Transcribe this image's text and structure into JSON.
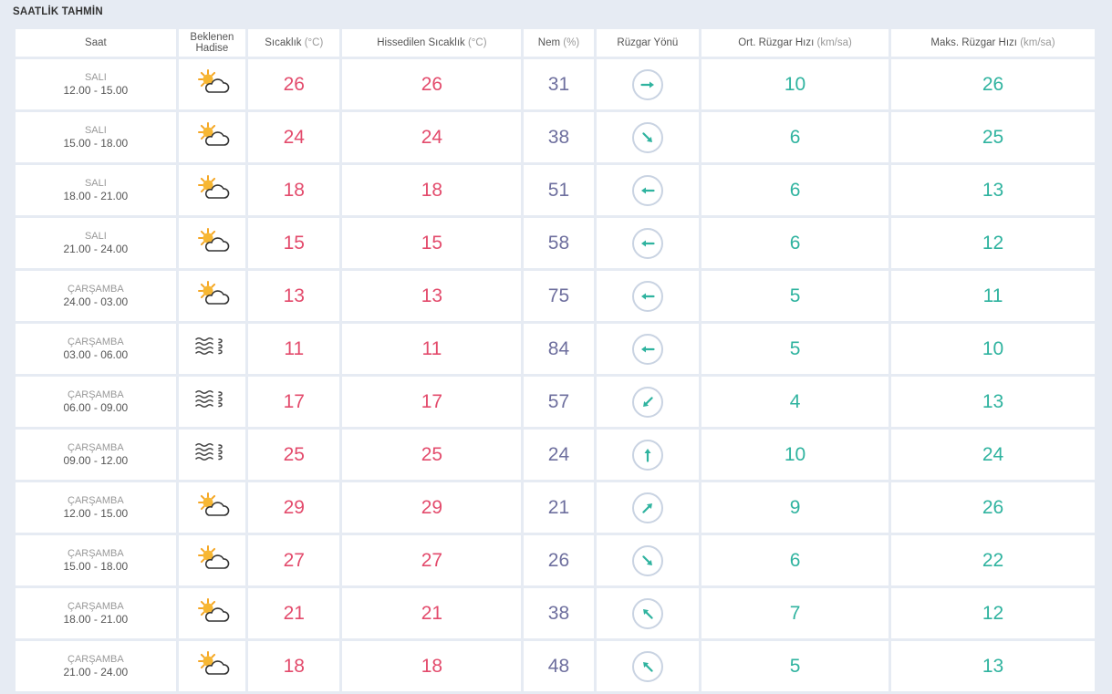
{
  "section_title": "SAATLİK TAHMİN",
  "colors": {
    "temperature": "#e34b6c",
    "humidity": "#6e6f9e",
    "wind_speed": "#2fb39f",
    "wind_arrow": "#2fb39f"
  },
  "headers": {
    "time": "Saat",
    "event_line1": "Beklenen",
    "event_line2": "Hadise",
    "temp": "Sıcaklık",
    "temp_unit": "(°C)",
    "feels": "Hissedilen Sıcaklık",
    "feels_unit": "(°C)",
    "humidity": "Nem",
    "humidity_unit": "(%)",
    "wind_dir": "Rüzgar Yönü",
    "avg_wind": "Ort. Rüzgar Hızı",
    "avg_wind_unit": "(km/sa)",
    "max_wind": "Maks. Rüzgar Hızı",
    "max_wind_unit": "(km/sa)"
  },
  "rows": [
    {
      "day": "SALI",
      "time": "12.00 - 15.00",
      "icon": "partly-cloudy-icon",
      "temp": "26",
      "feels": "26",
      "humidity": "31",
      "wind_dir": "east-arrow-icon",
      "avg_wind": "10",
      "max_wind": "26"
    },
    {
      "day": "SALI",
      "time": "15.00 - 18.00",
      "icon": "partly-cloudy-icon",
      "temp": "24",
      "feels": "24",
      "humidity": "38",
      "wind_dir": "southeast-arrow-icon",
      "avg_wind": "6",
      "max_wind": "25"
    },
    {
      "day": "SALI",
      "time": "18.00 - 21.00",
      "icon": "partly-cloudy-icon",
      "temp": "18",
      "feels": "18",
      "humidity": "51",
      "wind_dir": "west-arrow-icon",
      "avg_wind": "6",
      "max_wind": "13"
    },
    {
      "day": "SALI",
      "time": "21.00 - 24.00",
      "icon": "partly-cloudy-icon",
      "temp": "15",
      "feels": "15",
      "humidity": "58",
      "wind_dir": "west-arrow-icon",
      "avg_wind": "6",
      "max_wind": "12"
    },
    {
      "day": "ÇARŞAMBA",
      "time": "24.00 - 03.00",
      "icon": "partly-cloudy-icon",
      "temp": "13",
      "feels": "13",
      "humidity": "75",
      "wind_dir": "west-arrow-icon",
      "avg_wind": "5",
      "max_wind": "11"
    },
    {
      "day": "ÇARŞAMBA",
      "time": "03.00 - 06.00",
      "icon": "haze-icon",
      "temp": "11",
      "feels": "11",
      "humidity": "84",
      "wind_dir": "west-arrow-icon",
      "avg_wind": "5",
      "max_wind": "10"
    },
    {
      "day": "ÇARŞAMBA",
      "time": "06.00 - 09.00",
      "icon": "haze-icon",
      "temp": "17",
      "feels": "17",
      "humidity": "57",
      "wind_dir": "southwest-arrow-icon",
      "avg_wind": "4",
      "max_wind": "13"
    },
    {
      "day": "ÇARŞAMBA",
      "time": "09.00 - 12.00",
      "icon": "haze-icon",
      "temp": "25",
      "feels": "25",
      "humidity": "24",
      "wind_dir": "north-arrow-icon",
      "avg_wind": "10",
      "max_wind": "24"
    },
    {
      "day": "ÇARŞAMBA",
      "time": "12.00 - 15.00",
      "icon": "partly-cloudy-icon",
      "temp": "29",
      "feels": "29",
      "humidity": "21",
      "wind_dir": "northeast-arrow-icon",
      "avg_wind": "9",
      "max_wind": "26"
    },
    {
      "day": "ÇARŞAMBA",
      "time": "15.00 - 18.00",
      "icon": "partly-cloudy-icon",
      "temp": "27",
      "feels": "27",
      "humidity": "26",
      "wind_dir": "southeast-arrow-icon",
      "avg_wind": "6",
      "max_wind": "22"
    },
    {
      "day": "ÇARŞAMBA",
      "time": "18.00 - 21.00",
      "icon": "partly-cloudy-icon",
      "temp": "21",
      "feels": "21",
      "humidity": "38",
      "wind_dir": "northwest-arrow-icon",
      "avg_wind": "7",
      "max_wind": "12"
    },
    {
      "day": "ÇARŞAMBA",
      "time": "21.00 - 24.00",
      "icon": "partly-cloudy-icon",
      "temp": "18",
      "feels": "18",
      "humidity": "48",
      "wind_dir": "northwest-arrow-icon",
      "avg_wind": "5",
      "max_wind": "13"
    }
  ]
}
